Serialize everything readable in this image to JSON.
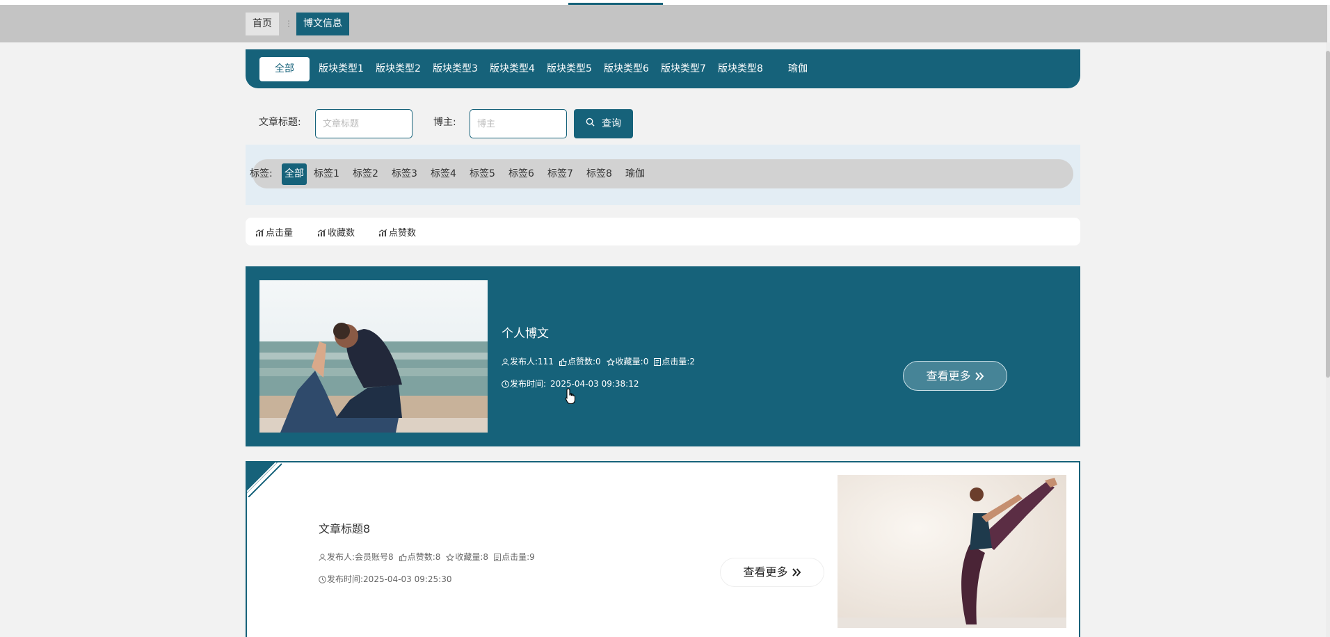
{
  "breadcrumb": {
    "home": "首页",
    "separator": "⋮",
    "current": "博文信息"
  },
  "categories": {
    "items": [
      "全部",
      "版块类型1",
      "版块类型2",
      "版块类型3",
      "版块类型4",
      "版块类型5",
      "版块类型6",
      "版块类型7",
      "版块类型8",
      "瑜伽"
    ],
    "active_index": 0
  },
  "search": {
    "title_label": "文章标题:",
    "title_placeholder": "文章标题",
    "author_label": "博主:",
    "author_placeholder": "博主",
    "button_label": "查询"
  },
  "tags": {
    "label": "标签:",
    "items": [
      "全部",
      "标签1",
      "标签2",
      "标签3",
      "标签4",
      "标签5",
      "标签6",
      "标签7",
      "标签8",
      "瑜伽"
    ],
    "active_index": 0
  },
  "sort": {
    "items": [
      "点击量",
      "收藏数",
      "点赞数"
    ]
  },
  "posts": [
    {
      "title": "个人博文",
      "publisher_label": "发布人:",
      "publisher": "111",
      "likes_label": "点赞数:",
      "likes": "0",
      "favorites_label": "收藏量:",
      "favorites": "0",
      "clicks_label": "点击量:",
      "clicks": "2",
      "time_label": "发布时间:",
      "time": "2025-04-03 09:38:12",
      "more_label": "查看更多",
      "more_icon": "double-chevron-right-icon"
    },
    {
      "title": "文章标题8",
      "publisher_label": "发布人:",
      "publisher": "会员账号8",
      "likes_label": "点赞数:",
      "likes": "8",
      "favorites_label": "收藏量:",
      "favorites": "8",
      "clicks_label": "点击量:",
      "clicks": "9",
      "time_label": "发布时间:",
      "time": "2025-04-03 09:25:30",
      "more_label": "查看更多",
      "more_icon": "double-chevron-right-icon"
    }
  ],
  "colors": {
    "primary": "#16627a",
    "background": "#f2f2f2",
    "breadcrumb_bar": "#c4c4c4",
    "tag_panel": "#e3edf4"
  }
}
